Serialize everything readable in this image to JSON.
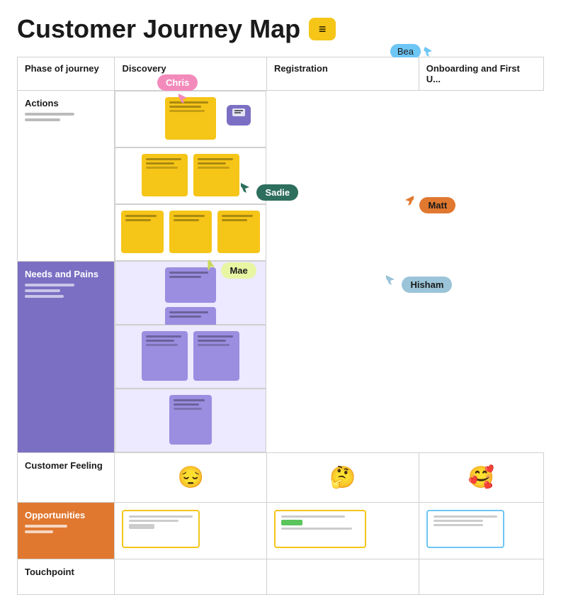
{
  "page": {
    "title": "Customer Journey Map"
  },
  "cursors": {
    "bea": {
      "label": "Bea"
    },
    "chris": {
      "label": "Chris"
    },
    "sadie": {
      "label": "Sadie"
    },
    "matt": {
      "label": "Matt"
    },
    "mae": {
      "label": "Mae"
    },
    "hisham": {
      "label": "Hisham"
    }
  },
  "table": {
    "headers": {
      "phase": "Phase of journey",
      "discovery": "Discovery",
      "registration": "Registration",
      "onboarding": "Onboarding and First U..."
    },
    "rows": {
      "actions": "Actions",
      "needs": "Needs and Pains",
      "feeling": "Customer Feeling",
      "opportunities": "Opportunities",
      "touchpoint": "Touchpoint"
    }
  },
  "icons": {
    "chat": "💬",
    "emoji_pensive": "😔",
    "emoji_thinking": "🤔",
    "emoji_flirt": "🥰"
  }
}
